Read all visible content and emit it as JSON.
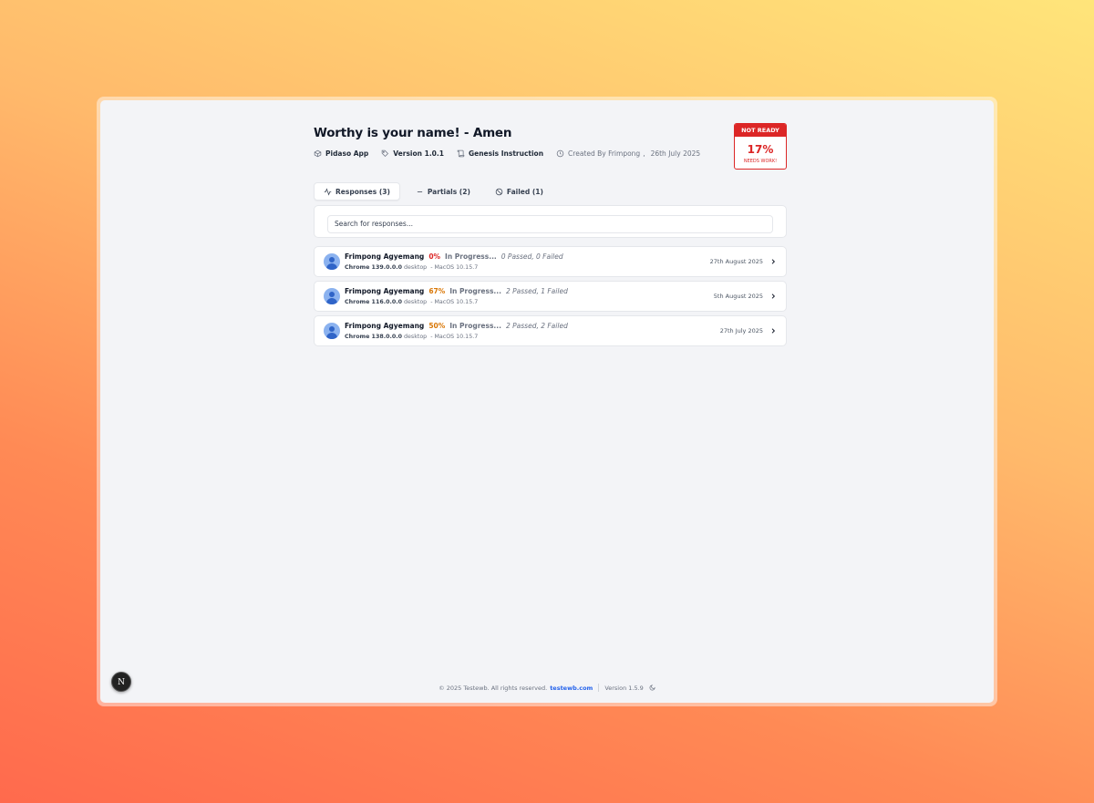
{
  "page": {
    "title": "Worthy is your name! - Amen"
  },
  "meta": {
    "app": "Pidaso App",
    "version": "Version 1.0.1",
    "instruction": "Genesis Instruction",
    "created_by": "Created By Frimpong",
    "separator": ",",
    "created_date": "26th July 2025"
  },
  "badge": {
    "label": "NOT READY",
    "percent": "17%",
    "sub": "NEEDS WORK!",
    "color": "#dc2626"
  },
  "tabs": [
    {
      "label": "Responses (3)",
      "icon": "activity-icon",
      "active": true
    },
    {
      "label": "Partials (2)",
      "icon": "minus-icon",
      "active": false
    },
    {
      "label": "Failed (1)",
      "icon": "ban-icon",
      "active": false
    }
  ],
  "search": {
    "placeholder": "Search for responses...",
    "value": ""
  },
  "responses": [
    {
      "name": "Frimpong Agyemang",
      "percent": "0%",
      "percent_color": "#dc2626",
      "status": "In Progress...",
      "summary": "0 Passed, 0 Failed",
      "browser": "Chrome 139.0.0.0",
      "device": "desktop",
      "os": "- MacOS 10.15.7",
      "date": "27th August 2025"
    },
    {
      "name": "Frimpong Agyemang",
      "percent": "67%",
      "percent_color": "#d97706",
      "status": "In Progress...",
      "summary": "2 Passed, 1 Failed",
      "browser": "Chrome 116.0.0.0",
      "device": "desktop",
      "os": "- MacOS 10.15.7",
      "date": "5th August 2025"
    },
    {
      "name": "Frimpong Agyemang",
      "percent": "50%",
      "percent_color": "#d97706",
      "status": "In Progress...",
      "summary": "2 Passed, 2 Failed",
      "browser": "Chrome 138.0.0.0",
      "device": "desktop",
      "os": "- MacOS 10.15.7",
      "date": "27th July 2025"
    }
  ],
  "footer": {
    "copyright": "© 2025 Testewb. All rights reserved.",
    "link": "testewb.com",
    "version": "Version 1.5.9"
  },
  "floating_button": {
    "label": "N"
  }
}
